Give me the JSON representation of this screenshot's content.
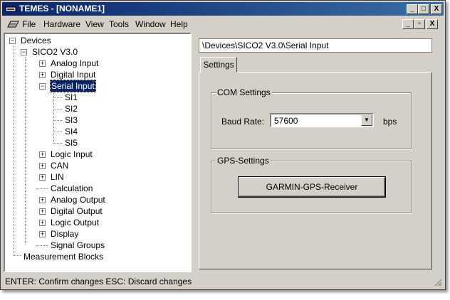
{
  "window": {
    "title": "TEMES - [NONAME1]",
    "caption_buttons": [
      "_",
      "□",
      "X"
    ],
    "mdi_buttons": [
      "_",
      "▫",
      "X"
    ]
  },
  "menubar": {
    "items": [
      "File",
      "Hardware",
      "View",
      "Tools",
      "Window",
      "Help"
    ]
  },
  "tree": {
    "root": "Devices",
    "device": "SICO2 V3.0",
    "items": [
      {
        "label": "Analog Input",
        "expander": "+"
      },
      {
        "label": "Digital Input",
        "expander": "+"
      },
      {
        "label": "Serial Input",
        "expander": "-",
        "selected": true
      },
      {
        "label": "SI1"
      },
      {
        "label": "SI2"
      },
      {
        "label": "SI3"
      },
      {
        "label": "SI4"
      },
      {
        "label": "SI5"
      },
      {
        "label": "Logic Input",
        "expander": "+"
      },
      {
        "label": "CAN",
        "expander": "+"
      },
      {
        "label": "LIN",
        "expander": "+"
      },
      {
        "label": "Calculation"
      },
      {
        "label": "Analog Output",
        "expander": "+"
      },
      {
        "label": "Digital Output",
        "expander": "+"
      },
      {
        "label": "Logic Output",
        "expander": "+"
      },
      {
        "label": "Display",
        "expander": "+"
      },
      {
        "label": "Signal Groups"
      }
    ],
    "bottom": "Measurement Blocks"
  },
  "right": {
    "path": "\\Devices\\SICO2 V3.0\\Serial Input",
    "tab": "Settings",
    "com_group": "COM Settings",
    "baud_label": "Baud Rate:",
    "baud_value": "57600",
    "baud_unit": "bps",
    "gps_group": "GPS-Settings",
    "gps_button": "GARMIN-GPS-Receiver"
  },
  "status": {
    "text": "ENTER: Confirm changes   ESC: Discard changes"
  },
  "colors": {
    "title_start": "#0a246a",
    "title_end": "#3a6ea5",
    "face": "#d4d0c8",
    "selection": "#0a246a"
  }
}
